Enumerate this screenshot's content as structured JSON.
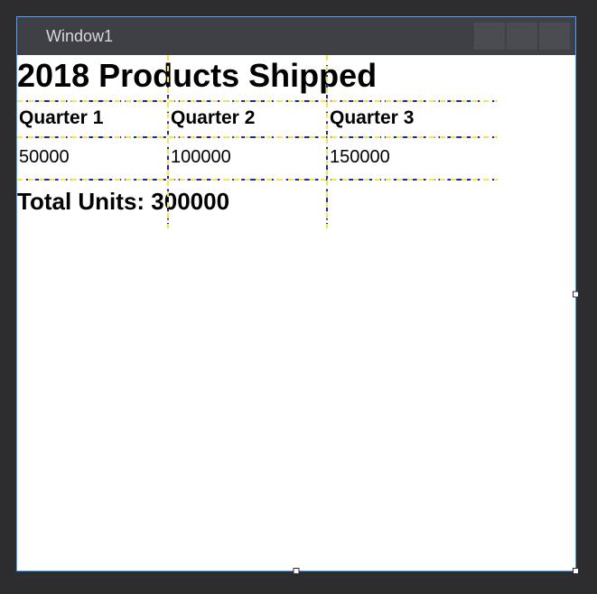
{
  "window": {
    "title": "Window1"
  },
  "content": {
    "heading": "2018 Products Shipped",
    "columns": [
      "Quarter 1",
      "Quarter 2",
      "Quarter 3"
    ],
    "values": [
      "50000",
      "100000",
      "150000"
    ],
    "total_label": "Total Units: 300000"
  }
}
